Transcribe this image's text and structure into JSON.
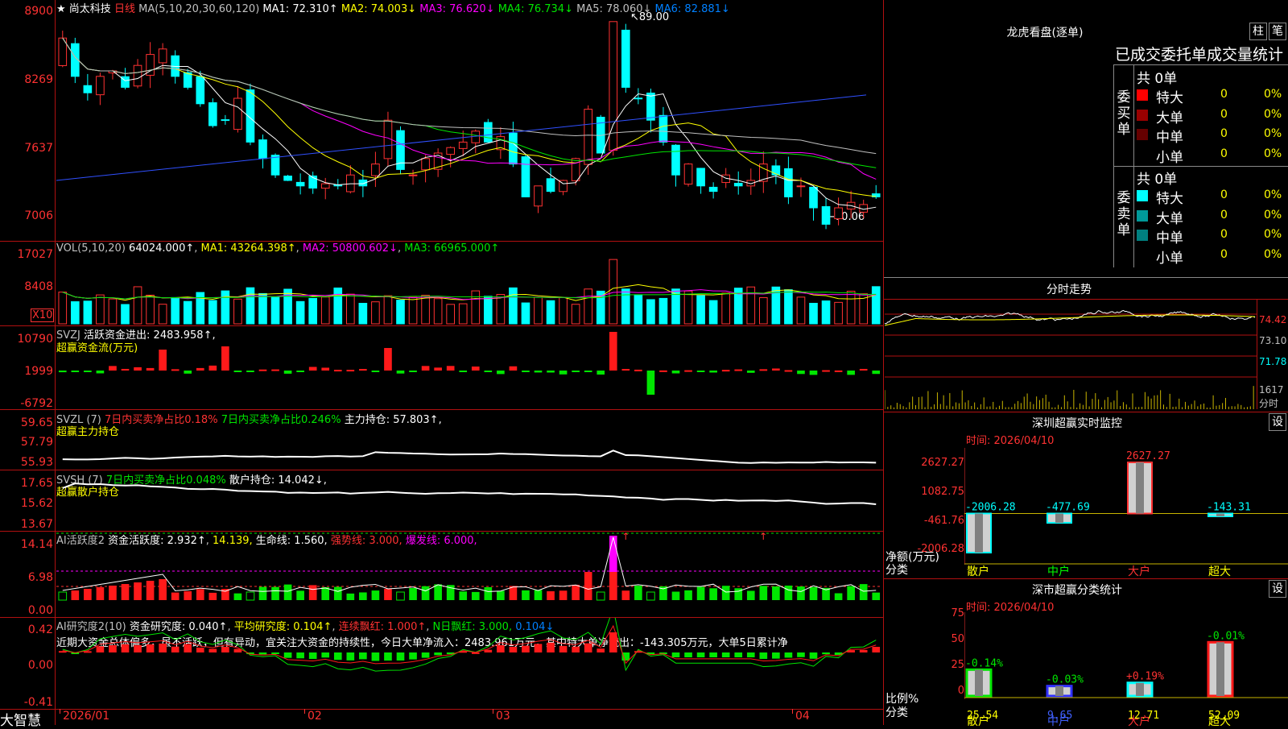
{
  "stock": {
    "name": "尚太科技",
    "period": "日线",
    "star": "★"
  },
  "main_ma": {
    "label": "MA(5,10,20,30,60,120)",
    "ma1": "MA1: 72.310↑",
    "ma2": "MA2: 74.003↓",
    "ma3": "MA3: 76.620↓",
    "ma4": "MA4: 76.734↓",
    "ma5": "MA5: 78.060↓",
    "ma6": "MA6: 82.881↓"
  },
  "main_axis": [
    "8900",
    "8269",
    "7637",
    "7006"
  ],
  "main_annotations": {
    "high": "89.00",
    "low": "70.06"
  },
  "vol": {
    "label": "VOL(5,10,20)",
    "val": "64024.000↑",
    "ma1": "MA1: 43264.398↑",
    "ma2": "MA2: 50800.602↓",
    "ma3": "MA3: 66965.000↑",
    "axis": [
      "17027",
      "8408"
    ],
    "unit": "X10"
  },
  "svzj": {
    "label": "SVZJ",
    "desc": "活跃资金进出: 2483.958↑,",
    "sub": "超赢资金流(万元)",
    "axis": [
      "10790",
      "1999",
      "-6792"
    ]
  },
  "svzl": {
    "label": "SVZL (7)",
    "a": "7日内买卖净占比0.18%",
    "b": "7日内买卖净占比0.246%",
    "c": "主力持仓: 57.803↑,",
    "sub": "超赢主力持仓",
    "axis": [
      "59.65",
      "57.79",
      "55.93"
    ]
  },
  "svsh": {
    "label": "SVSH (7)",
    "a": "7日内买卖净占比0.048%",
    "c": "散户持仓: 14.042↓,",
    "sub": "超赢散户持仓",
    "axis": [
      "17.65",
      "15.62",
      "13.67"
    ]
  },
  "ai1": {
    "label": "AI活跃度2",
    "a": "资金活跃度: 2.932↑",
    "b": "14.139,",
    "c": "生命线: 1.560,",
    "d": "强势线: 3.000,",
    "e": "爆发线: 6.000,",
    "axis": [
      "14.14",
      "6.98",
      "0.00"
    ]
  },
  "ai2": {
    "label": "AI研究度2(10)",
    "a": "资金研究度: 0.040↑",
    "b": "平均研究度: 0.104↑",
    "c": "连续飘红: 1.000↑",
    "d": "N日飘红: 3.000,",
    "e": "0.104↓",
    "note": "近期大资金总体偏多，虽不活跃，但有异动，宜关注大资金的持续性，今日大单净流入：2483.961万元，其中特大单净流出：-143.305万元，大单5日累计净",
    "axis": [
      "0.42",
      "0.00",
      "-0.41"
    ]
  },
  "date_axis": [
    "2026/01",
    "02",
    "03",
    "04"
  ],
  "brand": "大智慧",
  "right": {
    "dragon_title": "龙虎看盘(逐单)",
    "btn_zhu": "柱",
    "btn_bi": "笔",
    "stats_title": "已成交委托单成交量统计",
    "buy": {
      "side": "委买单",
      "total": "共 0单",
      "rows": [
        {
          "name": "特大",
          "v": "0",
          "p": "0%",
          "c": "#ff0000"
        },
        {
          "name": "大单",
          "v": "0",
          "p": "0%",
          "c": "#990000"
        },
        {
          "name": "中单",
          "v": "0",
          "p": "0%",
          "c": "#660000"
        },
        {
          "name": "小单",
          "v": "0",
          "p": "0%",
          "c": "#000000"
        }
      ]
    },
    "sell": {
      "side": "委卖单",
      "total": "共 0单",
      "rows": [
        {
          "name": "特大",
          "v": "0",
          "p": "0%",
          "c": "#00ffff"
        },
        {
          "name": "大单",
          "v": "0",
          "p": "0%",
          "c": "#009999"
        },
        {
          "name": "中单",
          "v": "0",
          "p": "0%",
          "c": "#008080"
        },
        {
          "name": "小单",
          "v": "0",
          "p": "0%",
          "c": "#000000"
        }
      ]
    },
    "intraday_title": "分时走势",
    "intraday_axis": [
      "74.42",
      "73.10",
      "71.78",
      "1617",
      "分时"
    ],
    "sz_monitor": {
      "title": "深圳超赢实时监控",
      "btn": "设",
      "time": "时间: 2026/04/10",
      "axis": [
        "2627.27",
        "1082.75",
        "-461.76",
        "-2006.28"
      ],
      "ylabel": "净额(万元)",
      "xlabel": "分类",
      "cats": [
        "散户",
        "中户",
        "大户",
        "超大"
      ],
      "values": [
        "-2006.28",
        "-477.69",
        "2627.27",
        "-143.31"
      ]
    },
    "sz_class": {
      "title": "深市超赢分类统计",
      "btn": "设",
      "time": "时间: 2026/04/10",
      "axis": [
        "75",
        "50",
        "25",
        "0"
      ],
      "ylabel": "比例%",
      "xlabel": "分类",
      "cats": [
        "散户",
        "中户",
        "大户",
        "超大"
      ],
      "top": [
        "-0.14%",
        "-0.03%",
        "+0.19%",
        "-0.01%"
      ],
      "values": [
        "25.54",
        "9.65",
        "12.71",
        "52.09"
      ]
    }
  }
}
